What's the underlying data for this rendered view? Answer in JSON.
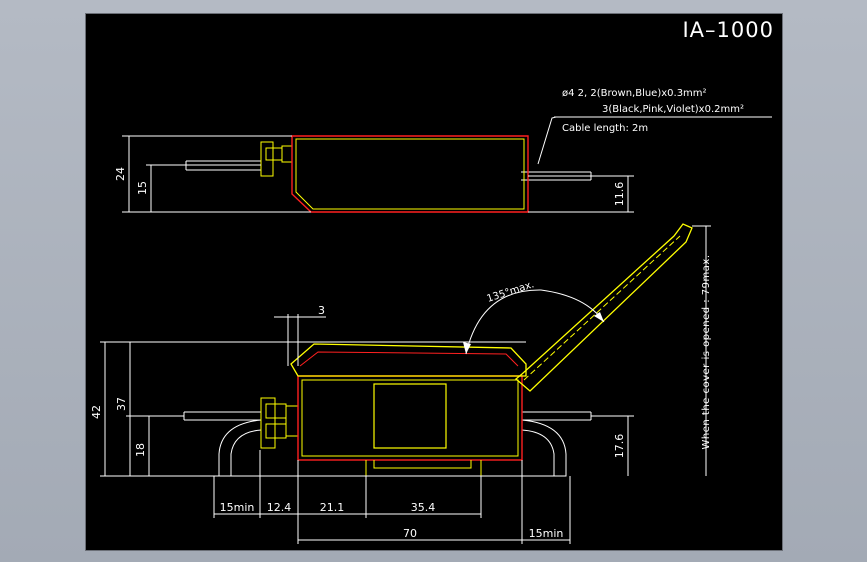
{
  "title": "IA–1000",
  "cable_spec": {
    "line1": "ø4 2,  2(Brown,Blue)x0.3mm²",
    "line2": "3(Black,Pink,Violet)x0.2mm²",
    "line3": "Cable length: 2m"
  },
  "top_view": {
    "dim_total_height": "24",
    "dim_cable_height": "15",
    "dim_right_cable_height": "11.6"
  },
  "side_view": {
    "dim_lever_width": "3",
    "dim_total_height": "42",
    "dim_body_height": "37",
    "dim_cable_height": "18",
    "dim_right_cable_height": "17.6",
    "angle_label": "135°max.",
    "cover_note": "When the cover is opened : 79max.",
    "dim_left_bend": "15min",
    "dim_connector": "12.4",
    "dim_section_a": "21.1",
    "dim_section_b": "35.4",
    "dim_body_length": "70",
    "dim_right_bend": "15min"
  },
  "colors": {
    "frame": "#a9b0bb",
    "background": "#000000",
    "outline": "#ffff00",
    "body": "#ff2020",
    "dimension": "#ffffff",
    "cable": "#ffffff"
  }
}
